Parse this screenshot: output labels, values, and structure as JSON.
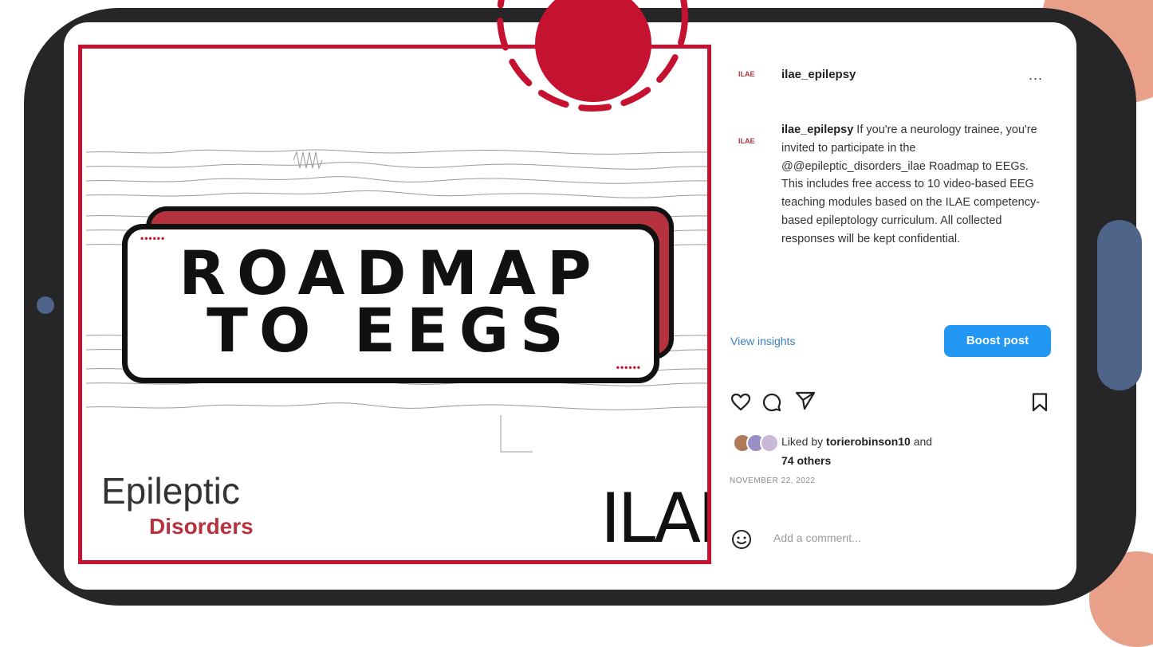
{
  "post": {
    "image": {
      "title_line1": "ROADMAP",
      "title_line2": "TO EEGS",
      "dots": "••••••",
      "logo_epileptic": "Epileptic",
      "logo_disorders": "Disorders",
      "logo_ilae": "ILAE"
    },
    "header": {
      "avatar_text": "ILAE",
      "username": "ilae_epilepsy",
      "more": "..."
    },
    "caption": {
      "avatar_text": "ILAE",
      "username": "ilae_epilepsy",
      "text": " If you're a neurology trainee, you're invited to participate in the @@epileptic_disorders_ilae Roadmap to EEGs. This includes free access to 10 video-based EEG teaching modules based on the ILAE competency-based epileptology curriculum. All collected responses will be kept confidential."
    },
    "view_insights": "View insights",
    "boost_post": "Boost post",
    "likes": {
      "prefix": "Liked by ",
      "user": "torierobinson10",
      "suffix": " and",
      "others": "74 others"
    },
    "date": "NOVEMBER 22, 2022",
    "comment_placeholder": "Add a comment..."
  },
  "colors": {
    "accent_red": "#c41230",
    "boost_blue": "#2196f3",
    "frame": "#262628",
    "side_button": "#4e6589"
  }
}
